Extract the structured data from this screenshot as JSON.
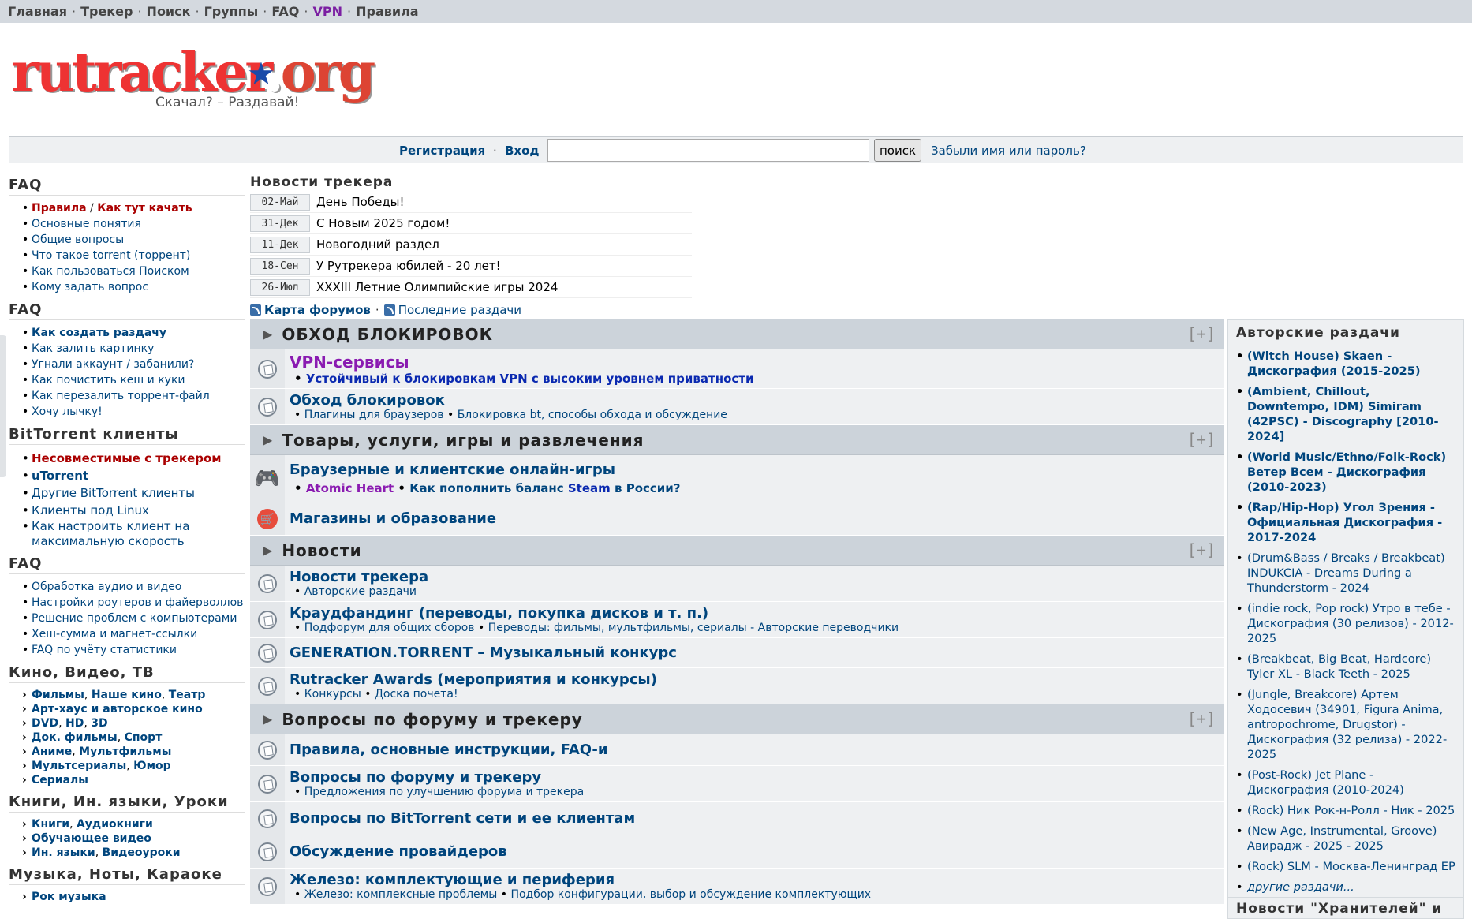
{
  "topnav": {
    "items": [
      "Главная",
      "Трекер",
      "Поиск",
      "Группы",
      "FAQ",
      "VPN",
      "Правила"
    ]
  },
  "logo": {
    "text_main": "rutracker",
    "text_org": "org",
    "tagline": "Скачал? – Раздавай!"
  },
  "login": {
    "register": "Регистрация",
    "sep": "·",
    "login": "Вход",
    "search_value": "",
    "search_button": "поиск",
    "forgot": "Забыли имя или пароль?"
  },
  "sidebar": {
    "faq1": {
      "title": "FAQ",
      "rules": "Правила",
      "how": "Как тут качать",
      "items": [
        "Основные понятия",
        "Общие вопросы",
        "Что такое torrent (торрент)",
        "Как пользоваться Поиском",
        "Кому задать вопрос"
      ]
    },
    "faq2": {
      "title": "FAQ",
      "items": [
        "Как создать раздачу",
        "Как залить картинку",
        "Угнали аккаунт / забанили?",
        "Как почистить кеш и куки",
        "Как перезалить торрент-файл",
        "Хочу лычку!"
      ]
    },
    "bt": {
      "title": "BitTorrent клиенты",
      "items": [
        "Несовместимые с трекером",
        "uTorrent",
        "Другие BitTorrent клиенты",
        "Клиенты под Linux",
        "Как настроить клиент на максимальную скорость"
      ]
    },
    "faq3": {
      "title": "FAQ",
      "items": [
        "Обработка аудио и видео",
        "Настройки роутеров и файерволлов",
        "Решение проблем с компьютерами",
        "Хеш-сумма и магнет-ссылки",
        "FAQ по учёту статистики"
      ]
    },
    "kino": {
      "title": "Кино, Видео, ТВ",
      "rows": [
        [
          "Фильмы",
          "Наше кино",
          "Театр"
        ],
        [
          "Арт-хаус и авторское кино"
        ],
        [
          "DVD",
          "HD",
          "3D"
        ],
        [
          "Док. фильмы",
          "Спорт"
        ],
        [
          "Аниме",
          "Мультфильмы"
        ],
        [
          "Мультсериалы",
          "Юмор"
        ],
        [
          "Сериалы"
        ]
      ]
    },
    "books": {
      "title": "Книги, Ин. языки, Уроки",
      "rows": [
        [
          "Книги",
          "Аудиокниги"
        ],
        [
          "Обучающее видео"
        ],
        [
          "Ин. языки",
          "Видеоуроки"
        ]
      ]
    },
    "music": {
      "title": "Музыка, Ноты, Караоке",
      "rows": [
        [
          "Рок музыка"
        ]
      ]
    }
  },
  "news": {
    "title": "Новости трекера",
    "items": [
      {
        "date": "02-Май",
        "text": "День Победы!"
      },
      {
        "date": "31-Дек",
        "text": "С Новым 2025 годом!"
      },
      {
        "date": "11-Дек",
        "text": "Новогодний раздел"
      },
      {
        "date": "18-Сен",
        "text": "У Рутрекера юбилей - 20 лет!"
      },
      {
        "date": "26-Июл",
        "text": "XXXIII Летние Олимпийские игры 2024"
      }
    ]
  },
  "maplinks": {
    "map": "Карта форумов",
    "sep": "·",
    "latest": "Последние раздачи"
  },
  "forums": {
    "cat1": {
      "name": "ОБХОД БЛОКИРОВОК",
      "plus": "[+]"
    },
    "vpn": {
      "name": "VPN-сервисы",
      "sub": "Устойчивый к блокировкам VPN с высоким уровнем приватности"
    },
    "bypass": {
      "name": "Обход блокировок",
      "subs": [
        "Плагины для браузеров",
        "Блокировка bt, способы обхода и обсуждение"
      ]
    },
    "cat2": {
      "name": "Товары, услуги, игры и развлечения",
      "plus": "[+]"
    },
    "games": {
      "name": "Браузерные и клиентские онлайн-игры",
      "sub1": "Atomic Heart",
      "sub2a": "Как пополнить баланс",
      "sub2b": "Steam",
      "sub2c": "в России?"
    },
    "shops": {
      "name": "Магазины и образование"
    },
    "cat3": {
      "name": "Новости",
      "plus": "[+]"
    },
    "trnews": {
      "name": "Новости трекера",
      "subs": [
        "Авторские раздачи"
      ]
    },
    "crowd": {
      "name": "Краудфандинг (переводы, покупка дисков и т. п.)",
      "subs": [
        "Подфорум для общих сборов",
        "Переводы: фильмы, мультфильмы, сериалы - Авторские переводчики"
      ]
    },
    "gen": {
      "name": "GENERATION.TORRENT – Музыкальный конкурс"
    },
    "awards": {
      "name": "Rutracker Awards (мероприятия и конкурсы)",
      "subs": [
        "Конкурсы",
        "Доска почета!"
      ]
    },
    "cat4": {
      "name": "Вопросы по форуму и трекеру",
      "plus": "[+]"
    },
    "rules": {
      "name": "Правила, основные инструкции, FAQ-и"
    },
    "questions": {
      "name": "Вопросы по форуму и трекеру",
      "subs": [
        "Предложения по улучшению форума и трекера"
      ]
    },
    "btq": {
      "name": "Вопросы по BitTorrent сети и ее клиентам"
    },
    "prov": {
      "name": "Обсуждение провайдеров"
    },
    "hw": {
      "name": "Железо: комплектующие и периферия",
      "subs": [
        "Железо: комплексные проблемы",
        "Подбор конфигурации, выбор и обсуждение комплектующих"
      ]
    }
  },
  "right": {
    "title": "Авторские раздачи",
    "items": [
      {
        "text": "(Witch House) Skaen - Дискография (2015-2025)",
        "bold": true
      },
      {
        "text": "(Ambient, Chillout, Downtempo, IDM) Simiram (42PSC) - Discography [2010-2024]",
        "bold": true
      },
      {
        "text": "(World Music/Ethno/Folk-Rock) Ветер Всем - Дискография (2010-2023)",
        "bold": true
      },
      {
        "text": "(Rap/Hip-Hop) Угол Зрения - Официальная Дискография - 2017-2024",
        "bold": true
      },
      {
        "text": "(Drum&Bass / Breaks / Breakbeat) INDUKCIA - Dreams During a Thunderstorm - 2024",
        "bold": false
      },
      {
        "text": "(indie rock, Pop rock) Утро в тебе - Дискография (30 релизов) - 2012-2025",
        "bold": false
      },
      {
        "text": "(Breakbeat, Big Beat, Hardcore) Tyler XL - Black Teeth - 2025",
        "bold": false
      },
      {
        "text": "(Jungle, Breakcore) Артем Ходосевич (34901, Figura Anima, antropochrome, Drugstor) - Дискография (32 релиза) - 2022-2025",
        "bold": false
      },
      {
        "text": "(Post-Rock) Jet Plane - Дискография (2010-2024)",
        "bold": false
      },
      {
        "text": "(Rock) Ник Рок-н-Ролл - Ник - 2025",
        "bold": false
      },
      {
        "text": "(New Age, Instrumental, Groove) Авирадж - 2025 - 2025",
        "bold": false
      },
      {
        "text": "(Rock) SLM - Москва-Ленинград EP",
        "bold": false
      }
    ],
    "more": "другие раздачи...",
    "title2": "Новости \"Хранителей\" и"
  }
}
